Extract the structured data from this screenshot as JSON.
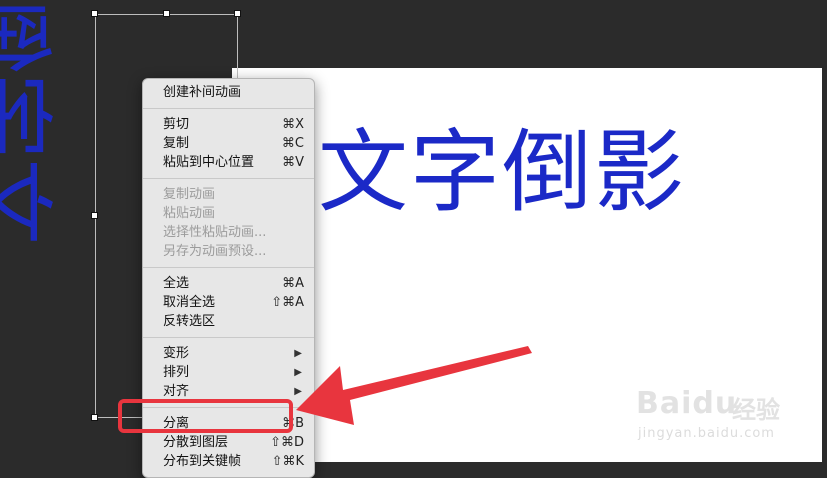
{
  "stage": {
    "title_text": "文字倒影",
    "mirror_text": "文字倒影"
  },
  "context_menu": {
    "groups": [
      {
        "items": [
          {
            "label": "创建补间动画",
            "shortcut": "",
            "disabled": false,
            "submenu": false
          }
        ]
      },
      {
        "items": [
          {
            "label": "剪切",
            "shortcut": "⌘X",
            "disabled": false,
            "submenu": false
          },
          {
            "label": "复制",
            "shortcut": "⌘C",
            "disabled": false,
            "submenu": false
          },
          {
            "label": "粘贴到中心位置",
            "shortcut": "⌘V",
            "disabled": false,
            "submenu": false
          }
        ]
      },
      {
        "items": [
          {
            "label": "复制动画",
            "shortcut": "",
            "disabled": true,
            "submenu": false
          },
          {
            "label": "粘贴动画",
            "shortcut": "",
            "disabled": true,
            "submenu": false
          },
          {
            "label": "选择性粘贴动画...",
            "shortcut": "",
            "disabled": true,
            "submenu": false
          },
          {
            "label": "另存为动画预设...",
            "shortcut": "",
            "disabled": true,
            "submenu": false
          }
        ]
      },
      {
        "items": [
          {
            "label": "全选",
            "shortcut": "⌘A",
            "disabled": false,
            "submenu": false
          },
          {
            "label": "取消全选",
            "shortcut": "⇧⌘A",
            "disabled": false,
            "submenu": false
          },
          {
            "label": "反转选区",
            "shortcut": "",
            "disabled": false,
            "submenu": false
          }
        ]
      },
      {
        "items": [
          {
            "label": "变形",
            "shortcut": "",
            "disabled": false,
            "submenu": true
          },
          {
            "label": "排列",
            "shortcut": "",
            "disabled": false,
            "submenu": true
          },
          {
            "label": "对齐",
            "shortcut": "",
            "disabled": false,
            "submenu": true
          }
        ]
      },
      {
        "items": [
          {
            "label": "分离",
            "shortcut": "⌘B",
            "disabled": false,
            "submenu": false
          },
          {
            "label": "分散到图层",
            "shortcut": "⇧⌘D",
            "disabled": false,
            "submenu": false
          },
          {
            "label": "分布到关键帧",
            "shortcut": "⇧⌘K",
            "disabled": false,
            "submenu": false
          }
        ]
      }
    ]
  },
  "watermark": {
    "brand": "Baidu",
    "brand_cn": "经验",
    "url": "jingyan.baidu.com"
  },
  "colors": {
    "text_blue": "#1b29c7",
    "highlight_red": "#e8353e",
    "menu_bg": "#e7e7e7",
    "background": "#2b2b2b",
    "stage": "#ffffff"
  }
}
